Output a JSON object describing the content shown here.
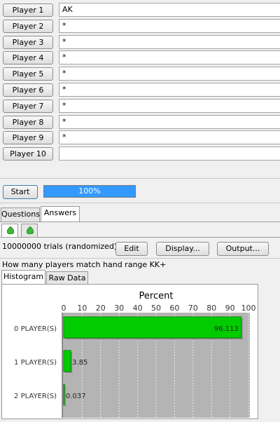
{
  "players": [
    {
      "label": "Player 1",
      "value": "AK"
    },
    {
      "label": "Player 2",
      "value": "*"
    },
    {
      "label": "Player 3",
      "value": "*"
    },
    {
      "label": "Player 4",
      "value": "*"
    },
    {
      "label": "Player 5",
      "value": "*"
    },
    {
      "label": "Player 6",
      "value": "*"
    },
    {
      "label": "Player 7",
      "value": "*"
    },
    {
      "label": "Player 8",
      "value": "*"
    },
    {
      "label": "Player 9",
      "value": "*"
    },
    {
      "label": "Player 10",
      "value": ""
    }
  ],
  "controls": {
    "start_label": "Start",
    "progress_text": "100%",
    "progress_fraction": 1.0
  },
  "tabs": {
    "questions": "Questions",
    "answers": "Answers"
  },
  "results": {
    "trials_text": "10000000 trials (randomized)",
    "edit_label": "Edit",
    "display_label": "Display...",
    "output_label": "Output...",
    "question_text": "How many players match hand range KK+",
    "tab_histogram": "Histogram",
    "tab_raw": "Raw Data"
  },
  "colors": {
    "bar": "#00cc00",
    "progress": "#3399ff",
    "plot_bg": "#b4b4b4"
  },
  "icons": [
    "drop-icon",
    "drop-icon"
  ],
  "chart_data": {
    "type": "bar",
    "orientation": "horizontal",
    "title": "Percent",
    "categories": [
      "0 PLAYER(S)",
      "1 PLAYER(S)",
      "2 PLAYER(S)"
    ],
    "values": [
      96.113,
      3.85,
      0.037
    ],
    "value_labels": [
      "96.113",
      "3.85",
      "0.037"
    ],
    "xlim": [
      0,
      100
    ],
    "xticks": [
      0,
      10,
      20,
      30,
      40,
      50,
      60,
      70,
      80,
      90,
      100
    ],
    "grid": true
  }
}
